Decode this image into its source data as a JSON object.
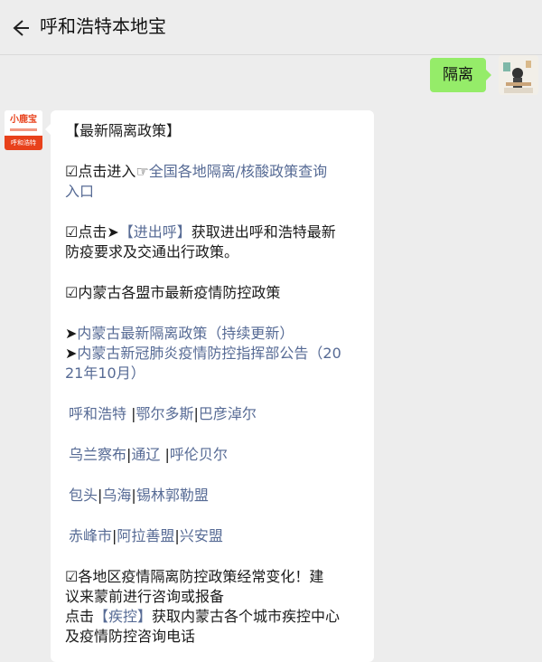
{
  "header": {
    "title": "呼和浩特本地宝"
  },
  "outgoing": {
    "text": "隔离"
  },
  "bot": {
    "avatar_top": "小鹿宝",
    "avatar_bottom": "呼和浩特"
  },
  "message": {
    "heading": "【最新隔离政策】",
    "p1_prefix": "☑点击进入☞",
    "p1_link_a": "全国各地隔离/核酸政策查询",
    "p1_link_b": "入口",
    "p2_prefix": "☑点击➤",
    "p2_link": "【进出呼】",
    "p2_text_a": "获取进出呼和浩特最新",
    "p2_text_b": "防疫要求及交通出行政策。",
    "p3": "☑内蒙古各盟市最新疫情防控政策",
    "arrow": "➤",
    "link_policy": "内蒙古最新隔离政策（持续更新）",
    "link_notice_a": "内蒙古新冠肺炎疫情防控指挥部公告（20",
    "link_notice_b": "21年10月）",
    "cities": [
      [
        "呼和浩特",
        "鄂尔多斯",
        "巴彦淖尔"
      ],
      [
        "乌兰察布",
        "通辽",
        "呼伦贝尔"
      ],
      [
        "包头",
        "乌海",
        "锡林郭勒盟"
      ],
      [
        "赤峰市",
        "阿拉善盟",
        "兴安盟"
      ]
    ],
    "sep": "|",
    "sep_spaced": " |",
    "note_a": "☑各地区疫情隔离防控政策经常变化！建",
    "note_b": "议来蒙前进行咨询或报备",
    "click": "点击",
    "cdc_link": "【疾控】",
    "cdc_text_a": "获取内蒙古各个城市疾控中心",
    "cdc_text_b": "及疫情防控咨询电话"
  }
}
